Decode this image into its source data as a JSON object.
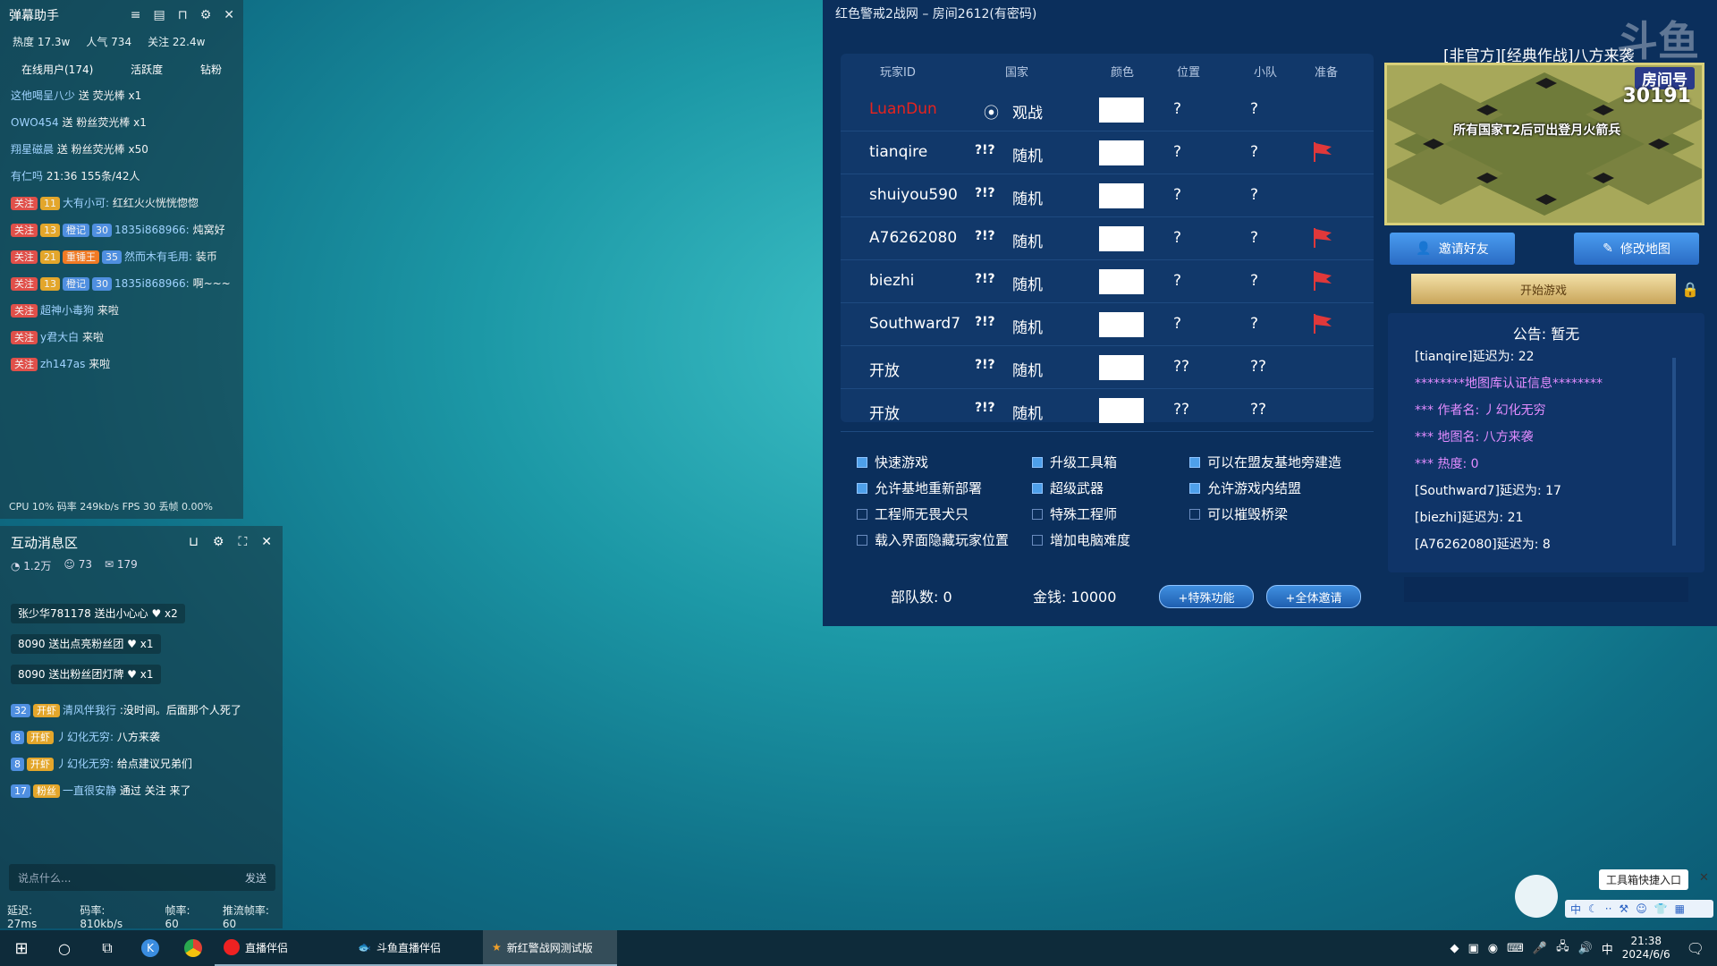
{
  "barrage": {
    "title": "弹幕助手",
    "stats": {
      "heat": "热度 17.3w",
      "popular": "人气 734",
      "follow": "关注 22.4w"
    },
    "tabs": [
      "在线用户(174)",
      "活跃度",
      "钻粉"
    ],
    "rows": [
      {
        "user": "这他喝呈八少",
        "text": "送 荧光棒",
        "count": "x1"
      },
      {
        "user": "OWO454",
        "text": "送 粉丝荧光棒",
        "count": "x1"
      },
      {
        "user": "翔星磁晨",
        "text": "送 粉丝荧光棒",
        "count": "x50"
      },
      {
        "user": "有仁吗",
        "text": "21:36",
        "count": "155条/42人"
      },
      {
        "tag1": "关注",
        "lv": "11",
        "user": "大有小可:",
        "text": "红红火火恍恍惚惚"
      },
      {
        "tag1": "关注",
        "lv": "13",
        "badge": "橙记",
        "lv2": "30",
        "user": "1835i868966:",
        "text": "炖窝好"
      },
      {
        "tag1": "关注",
        "lv": "21",
        "badge": "重锤王",
        "lv2": "35",
        "user": "然而木有毛用:",
        "text": "装币"
      },
      {
        "tag1": "关注",
        "lv": "13",
        "badge": "橙记",
        "lv2": "30",
        "user": "1835i868966:",
        "text": "啊~~~"
      },
      {
        "tag1": "关注",
        "user": "超神小毒狗",
        "text": "来啦"
      },
      {
        "tag1": "关注",
        "user": "y君大白",
        "text": "来啦"
      },
      {
        "tag1": "关注",
        "user": "zh147as",
        "text": "来啦"
      }
    ],
    "footer": "CPU 10%  码率 249kb/s  FPS 30  丢帧 0.00%"
  },
  "interact": {
    "title": "互动消息区",
    "sub": [
      "1.2万",
      "73",
      "179"
    ],
    "gifts": [
      {
        "text": "张少华781178 送出小心心",
        "count": "x2"
      },
      {
        "text": "8090 送出点亮粉丝团",
        "count": "x1"
      },
      {
        "text": "8090 送出粉丝团灯牌",
        "count": "x1"
      }
    ],
    "msgs": [
      {
        "lv": "32",
        "badge": "开虾",
        "user": "清风伴我行",
        "text": ":没时间。后面那个人死了"
      },
      {
        "lv": "8",
        "badge": "开虾",
        "user": "丿幻化无穷:",
        "text": "八方来袭"
      },
      {
        "lv": "8",
        "badge": "开虾",
        "user": "丿幻化无穷:",
        "text": "给点建议兄弟们"
      },
      {
        "lv": "17",
        "badge": "粉丝",
        "user": "一直很安静",
        "text": "通过 关注 来了"
      }
    ],
    "input_placeholder": "说点什么...",
    "send": "发送",
    "footer": [
      "延迟: 27ms",
      "码率: 810kb/s",
      "帧率: 60",
      "推流帧率: 60"
    ]
  },
  "game": {
    "title": "红色警戒2战网 – 房间2612(有密码)",
    "headers": [
      "玩家ID",
      "国家",
      "颜色",
      "位置",
      "小队",
      "准备"
    ],
    "players": [
      {
        "id": "LuanDun",
        "country": "观战",
        "pos": "?",
        "team": "?",
        "ready": false,
        "host": true
      },
      {
        "id": "tianqire",
        "country": "随机",
        "pos": "?",
        "team": "?",
        "ready": true
      },
      {
        "id": "shuiyou590",
        "country": "随机",
        "pos": "?",
        "team": "?",
        "ready": false
      },
      {
        "id": "A76262080",
        "country": "随机",
        "pos": "?",
        "team": "?",
        "ready": true
      },
      {
        "id": "biezhi",
        "country": "随机",
        "pos": "?",
        "team": "?",
        "ready": true
      },
      {
        "id": "Southward7",
        "country": "随机",
        "pos": "?",
        "team": "?",
        "ready": true
      },
      {
        "id": "开放",
        "country": "随机",
        "pos": "??",
        "team": "??",
        "ready": false
      },
      {
        "id": "开放",
        "country": "随机",
        "pos": "??",
        "team": "??",
        "ready": false
      }
    ],
    "random_glyph": "?!?",
    "options": [
      {
        "label": "快速游戏",
        "on": true
      },
      {
        "label": "升级工具箱",
        "on": true
      },
      {
        "label": "可以在盟友基地旁建造",
        "on": true
      },
      {
        "label": "允许基地重新部署",
        "on": true
      },
      {
        "label": "超级武器",
        "on": true
      },
      {
        "label": "允许游戏内结盟",
        "on": true
      },
      {
        "label": "工程师无畏犬只",
        "on": false
      },
      {
        "label": "特殊工程师",
        "on": false
      },
      {
        "label": "可以摧毁桥梁",
        "on": false
      },
      {
        "label": "载入界面隐藏玩家位置",
        "on": false
      },
      {
        "label": "增加电脑难度",
        "on": false
      }
    ],
    "units": "部队数: 0",
    "money": "金钱: 10000",
    "special_btn": "+特殊功能",
    "invite_all_btn": "+全体邀请",
    "map_title": "[非官方][经典作战]八方来袭",
    "room_label": "房间号",
    "room_no": "30191",
    "map_caption": "所有国家T2后可出登月火箭兵",
    "invite_btn": "邀请好友",
    "edit_map_btn": "修改地图",
    "start_btn": "开始游戏",
    "notice": "公告: 暂无",
    "log": [
      {
        "text": "[tianqire]延迟为: 22",
        "color": "#ffffff"
      },
      {
        "text": "********地图库认证信息********",
        "color": "#e38cff"
      },
      {
        "text": "*** 作者名: 丿幻化无穷",
        "color": "#e38cff"
      },
      {
        "text": "*** 地图名: 八方来袭",
        "color": "#e38cff"
      },
      {
        "text": "*** 热度: 0",
        "color": "#e38cff"
      },
      {
        "text": "[Southward7]延迟为: 17",
        "color": "#ffffff"
      },
      {
        "text": "[biezhi]延迟为: 21",
        "color": "#ffffff"
      },
      {
        "text": "[A76262080]延迟为: 8",
        "color": "#ffffff"
      }
    ],
    "brand": "斗鱼"
  },
  "toolbox": {
    "label": "工具箱快捷入口"
  },
  "taskbar": {
    "items": [
      "直播伴侣",
      "斗鱼直播伴侣",
      "新红警战网测试版"
    ],
    "ime": "中",
    "time": "21:38",
    "date": "2024/6/6"
  },
  "colors": {
    "host": "#e8231d",
    "accent": "#4ea0ea",
    "flag": "#e0383a"
  }
}
